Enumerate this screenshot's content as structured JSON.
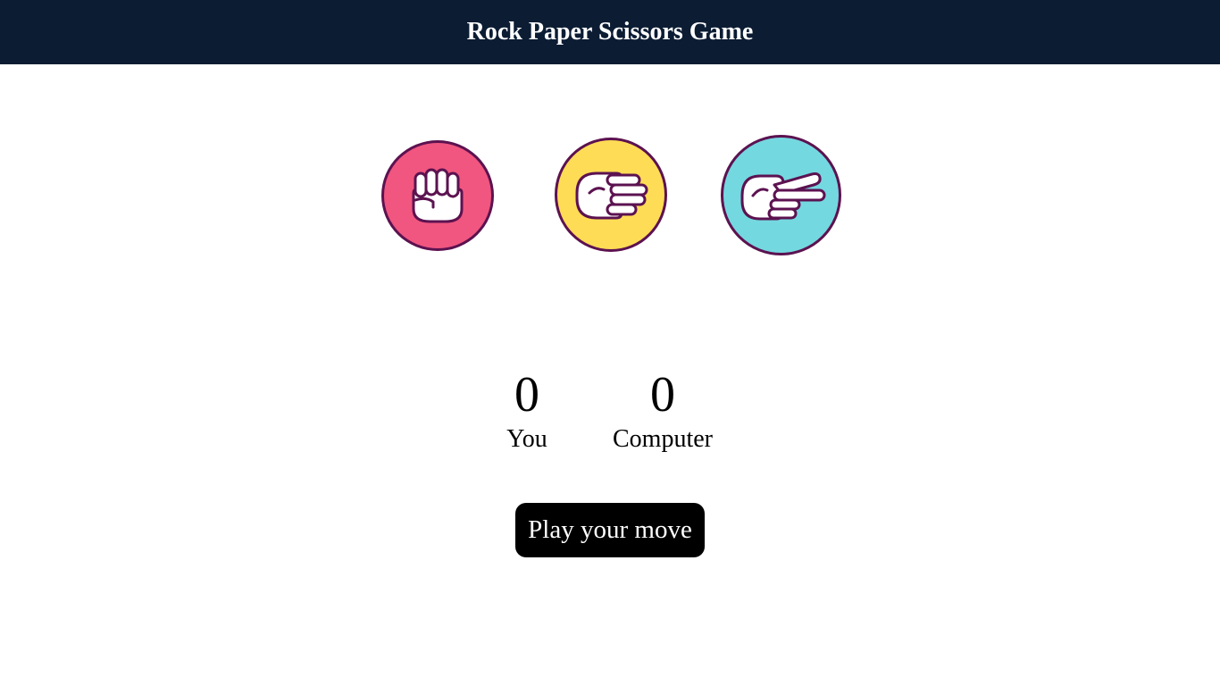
{
  "header": {
    "title": "Rock Paper Scissors Game"
  },
  "choices": [
    {
      "id": "rock",
      "icon": "rock-fist-icon",
      "color": "#f0567f"
    },
    {
      "id": "paper",
      "icon": "paper-hand-icon",
      "color": "#ffdc55"
    },
    {
      "id": "scissors",
      "icon": "scissors-hand-icon",
      "color": "#74d8e0"
    }
  ],
  "scoreboard": {
    "user": {
      "score": "0",
      "label": "You"
    },
    "computer": {
      "score": "0",
      "label": "Computer"
    }
  },
  "play_button": {
    "label": "Play your move"
  },
  "colors": {
    "navbar": "#0b1c33",
    "outline": "#5c1250"
  }
}
